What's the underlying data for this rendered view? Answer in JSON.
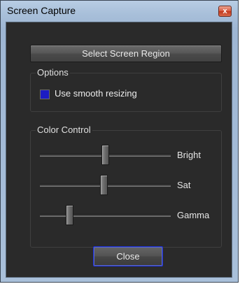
{
  "window": {
    "title": "Screen Capture",
    "close_glyph": "x"
  },
  "main": {
    "select_region_label": "Select Screen Region",
    "close_label": "Close"
  },
  "options": {
    "group_label": "Options",
    "smooth_resize_label": "Use smooth resizing",
    "smooth_resize_checked": true
  },
  "color_control": {
    "group_label": "Color Control",
    "sliders": [
      {
        "label": "Bright",
        "value": 0.5
      },
      {
        "label": "Sat",
        "value": 0.49
      },
      {
        "label": "Gamma",
        "value": 0.21
      }
    ]
  },
  "colors": {
    "checkbox_fill": "#1c1cc4",
    "focus_border": "#1f2fd0",
    "panel_bg": "#2a2a2a",
    "frame_bg": "#a9c0da"
  }
}
